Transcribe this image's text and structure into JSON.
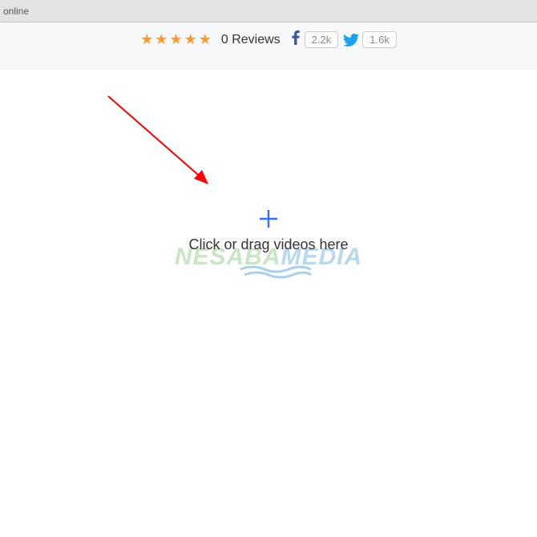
{
  "tab": {
    "text": "online"
  },
  "header": {
    "reviews_text": "0 Reviews",
    "facebook_count": "2.2k",
    "twitter_count": "1.6k"
  },
  "dropzone": {
    "prompt": "Click or drag videos here"
  },
  "watermark": {
    "part1": "NESABA",
    "part2": "MEDIA"
  }
}
